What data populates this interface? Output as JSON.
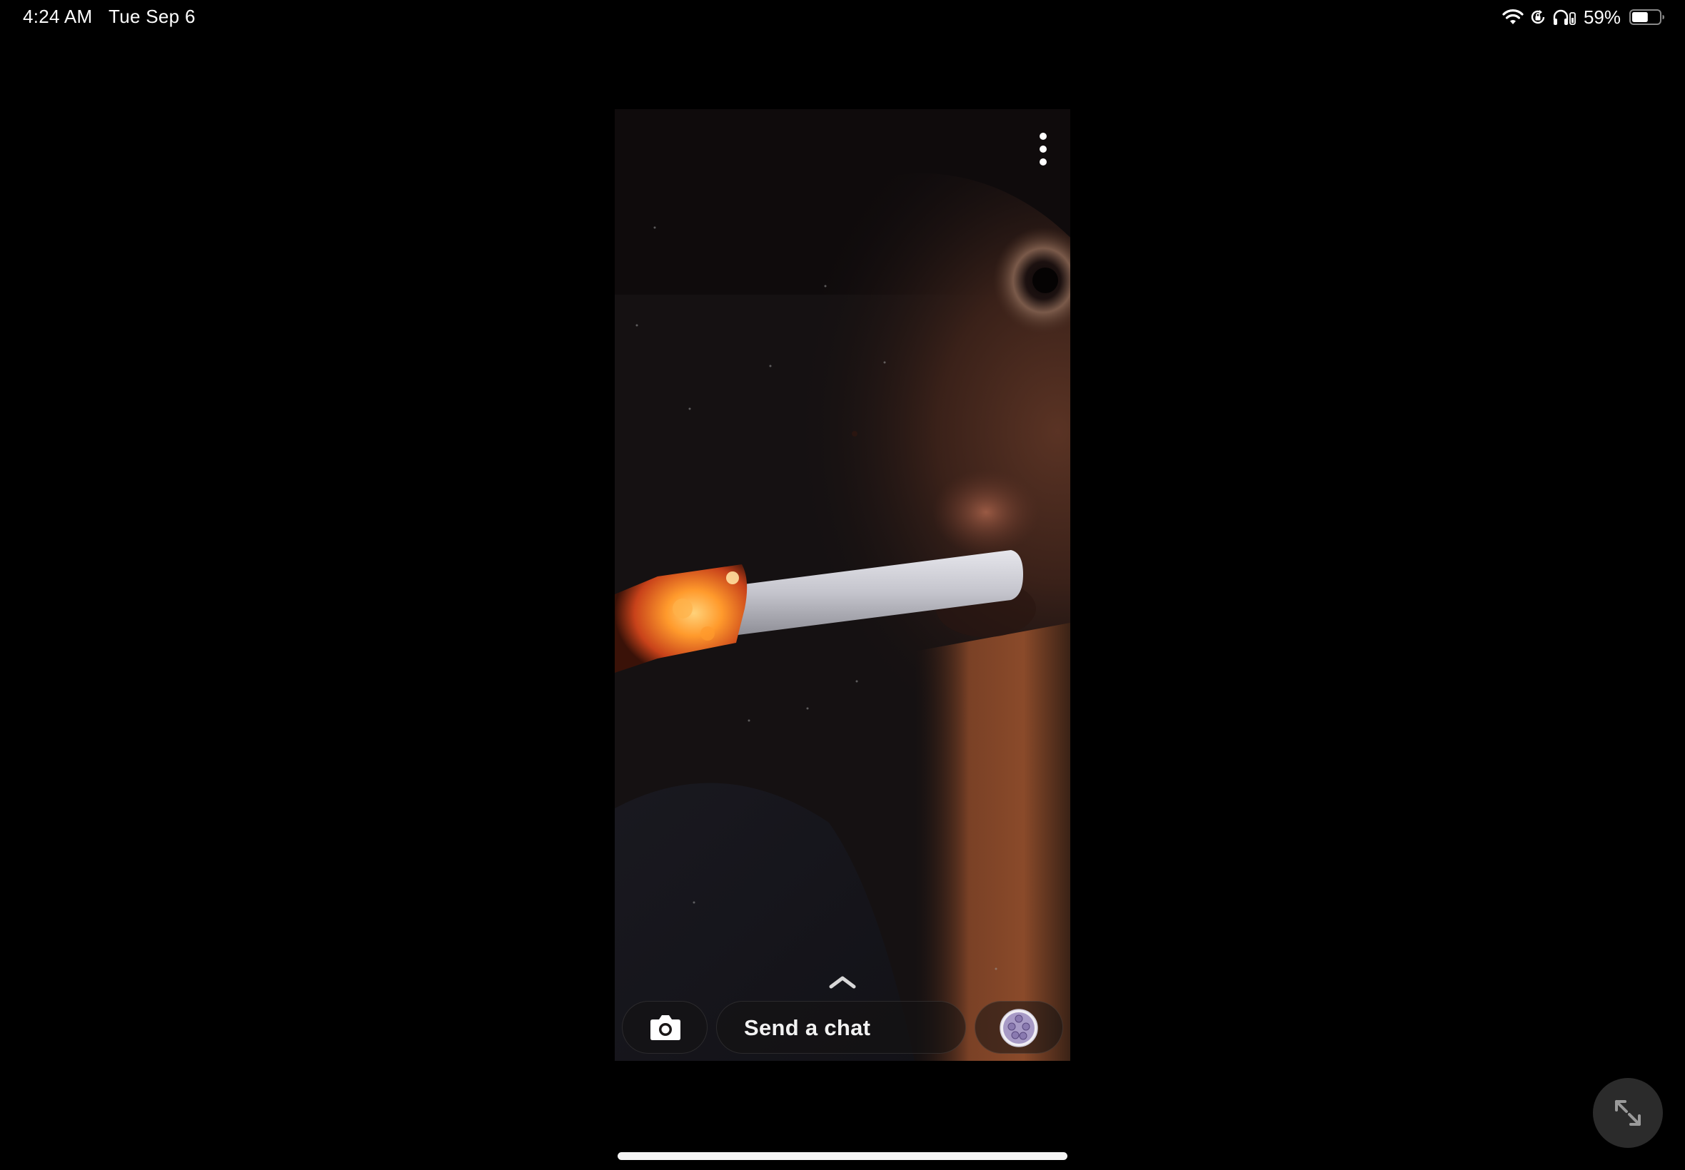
{
  "status_bar": {
    "time": "4:24 AM",
    "date": "Tue Sep 6",
    "battery_percent": "59%",
    "icons": [
      "wifi-icon",
      "orientation-lock-icon",
      "headphones-icon",
      "battery-icon"
    ],
    "battery_level": 0.59
  },
  "story": {
    "media": "photo",
    "more_icon": "more-vertical-icon",
    "swipe_up_icon": "chevron-up-icon",
    "bottom_bar": {
      "camera_icon": "camera-icon",
      "chat_placeholder": "Send a chat",
      "avatar_icon": "bitmoji-avatar-icon"
    }
  },
  "controls": {
    "expand_icon": "expand-diagonal-icon"
  },
  "colors": {
    "background": "#000000",
    "story_dark": "#151112",
    "skin": "#6b3a22",
    "ember": "#ff8a1f",
    "cigarette": "#c9c9cf",
    "button_bg": "#2b2b2b",
    "home_indicator": "#f4f4f4"
  }
}
